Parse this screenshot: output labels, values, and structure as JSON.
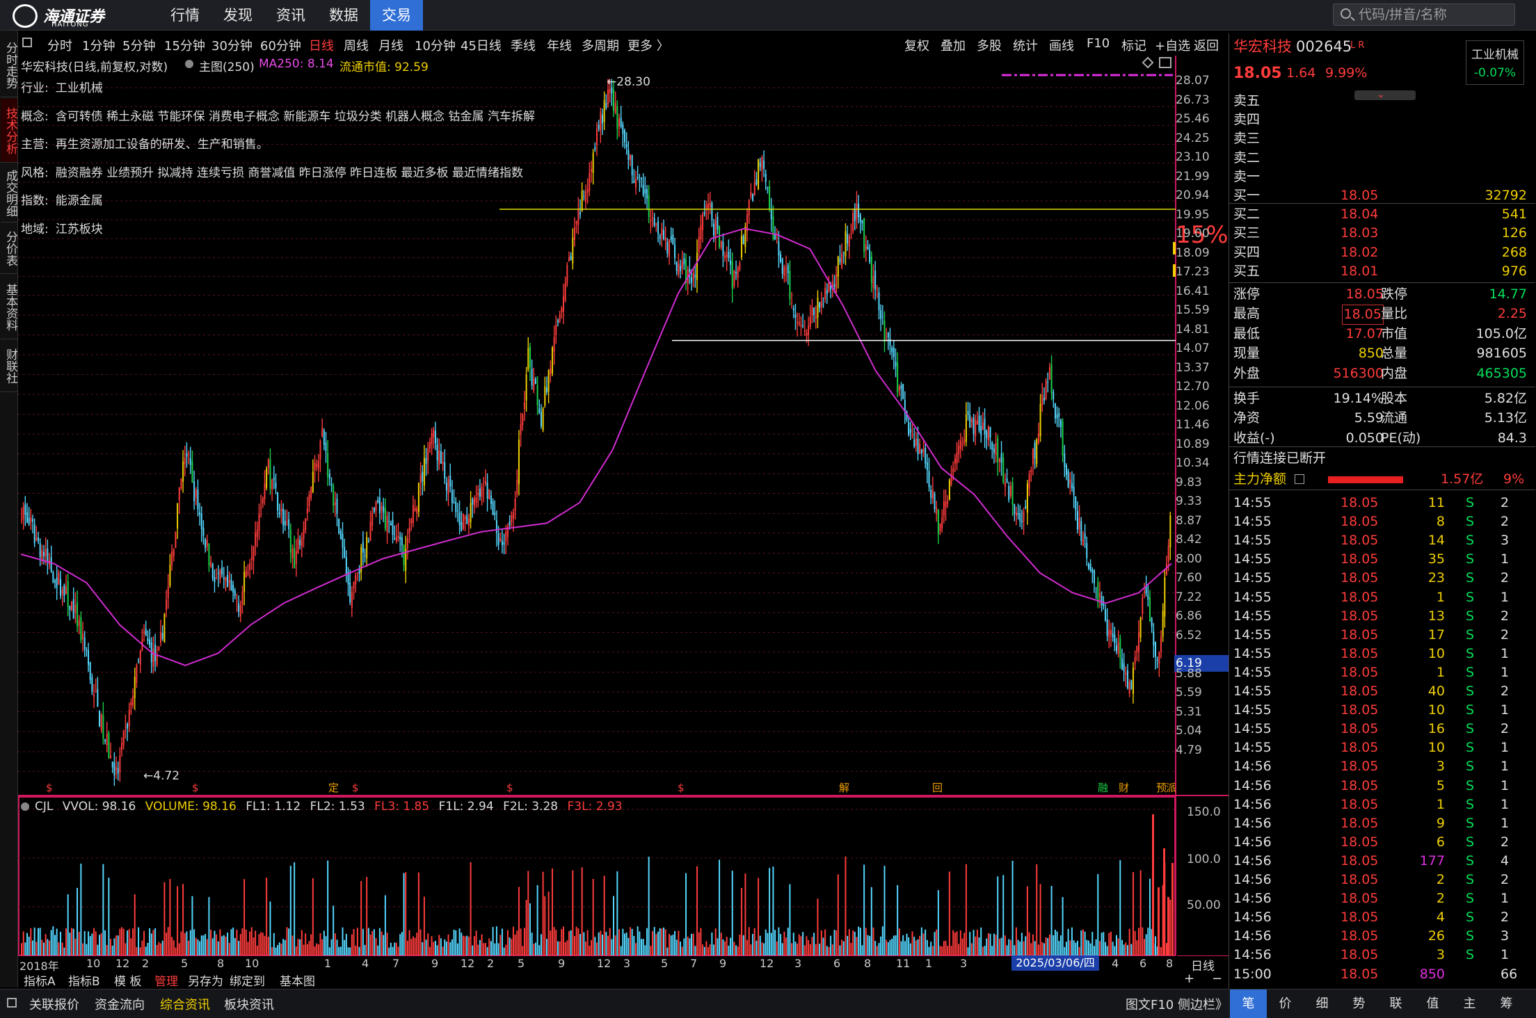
{
  "app": {
    "logo_cn": "海通证券",
    "logo_en": "HAITONG"
  },
  "topnav": [
    "行情",
    "发现",
    "资讯",
    "数据",
    "交易"
  ],
  "topnav_active": "交易",
  "search": {
    "placeholder": "代码/拼音/名称"
  },
  "left_tabs": [
    "分时走势",
    "技术分析",
    "成交明细",
    "分价表",
    "基本资料",
    "财联社"
  ],
  "left_tab_active": "技术分析",
  "periods": [
    "分时",
    "1分钟",
    "5分钟",
    "15分钟",
    "30分钟",
    "60分钟",
    "日线",
    "周线",
    "月线",
    "10分钟",
    "45日线",
    "季线",
    "年线",
    "多周期",
    "更多 〉"
  ],
  "period_active": "日线",
  "tools": [
    "复权",
    "叠加",
    "多股",
    "统计",
    "画线",
    "F10",
    "标记",
    "+自选",
    "返回"
  ],
  "header": {
    "stock": "华宏科技(日线,前复权,对数)",
    "main_label": "主图(250)",
    "ma_label": "MA250: 8.14",
    "float_label": "流通市值: 92.59"
  },
  "info_lines": [
    {
      "k": "行业:",
      "v": "工业机械"
    },
    {
      "k": "概念:",
      "v": "含可转债 稀土永磁 节能环保 消费电子概念 新能源车 垃圾分类 机器人概念 钴金属 汽车拆解"
    },
    {
      "k": "主营:",
      "v": "再生资源加工设备的研发、生产和销售。"
    },
    {
      "k": "风格:",
      "v": "融资融券 业绩预升 拟减持 连续亏损 商誉减值 昨日涨停 昨日连板 最近多板 最近情绪指数"
    },
    {
      "k": "指数:",
      "v": "能源金属"
    },
    {
      "k": "地域:",
      "v": "江苏板块"
    }
  ],
  "annotations": {
    "high": "28.30",
    "low": "4.72",
    "last_price_tag": "6.19",
    "limit_pct": "15%"
  },
  "event_marks": [
    "定",
    "解",
    "回",
    "融",
    "财",
    "预",
    "派"
  ],
  "sub_header": {
    "name": "CJL",
    "vvol": "VVOL: 98.16",
    "volume": "VOLUME: 98.16",
    "fl1": "FL1: 1.12",
    "fl2": "FL2: 1.53",
    "fl3": "FL3: 1.85",
    "f1l": "F1L: 2.94",
    "f2l": "F2L: 3.28",
    "f3l": "F3L: 2.93"
  },
  "x_axis": {
    "year": "2018年",
    "labels": [
      "10",
      "12",
      "2",
      "5",
      "8",
      "10",
      "1",
      "4",
      "7",
      "9",
      "12",
      "2",
      "5",
      "9",
      "12",
      "3",
      "5",
      "7",
      "9",
      "12",
      "3",
      "6",
      "8",
      "11",
      "1",
      "3",
      "4",
      "6",
      "8"
    ],
    "cursor_date": "2025/03/06/四",
    "period_tag": "日线"
  },
  "indicator_tabs": [
    "指标A",
    "指标B",
    "模 板",
    "管理",
    "另存为",
    "绑定到",
    "基本图"
  ],
  "indicator_active": "管理",
  "bottom_links": [
    "关联报价",
    "资金流向",
    "综合资讯",
    "板块资讯"
  ],
  "bottom_active": "综合资讯",
  "bottom_right": "图文F10 侧边栏》",
  "bottom_tabs": [
    "笔",
    "价",
    "细",
    "势",
    "联",
    "值",
    "主",
    "筹"
  ],
  "quote": {
    "name": "华宏科技",
    "code": "002645",
    "flags": "L R",
    "industry": "工业机械",
    "industry_chg": "-0.07%",
    "price": "18.05",
    "change": "1.64",
    "pct": "9.99%"
  },
  "sell_rows": [
    {
      "label": "卖五"
    },
    {
      "label": "卖四"
    },
    {
      "label": "卖三"
    },
    {
      "label": "卖二"
    },
    {
      "label": "卖一"
    }
  ],
  "buy_rows": [
    {
      "label": "买一",
      "price": "18.05",
      "vol": "32792"
    },
    {
      "label": "买二",
      "price": "18.04",
      "vol": "541"
    },
    {
      "label": "买三",
      "price": "18.03",
      "vol": "126"
    },
    {
      "label": "买四",
      "price": "18.02",
      "vol": "268"
    },
    {
      "label": "买五",
      "price": "18.01",
      "vol": "976"
    }
  ],
  "stats": [
    {
      "l1": "涨停",
      "v1": "18.05",
      "l2": "跌停",
      "v2": "14.77"
    },
    {
      "l1": "最高",
      "v1": "18.05",
      "l2": "量比",
      "v2": "2.25"
    },
    {
      "l1": "最低",
      "v1": "17.07",
      "l2": "市值",
      "v2": "105.0亿"
    },
    {
      "l1": "现量",
      "v1": "850",
      "l2": "总量",
      "v2": "981605"
    },
    {
      "l1": "外盘",
      "v1": "516300",
      "l2": "内盘",
      "v2": "465305"
    }
  ],
  "stats2": [
    {
      "l1": "换手",
      "v1": "19.14%",
      "l2": "股本",
      "v2": "5.82亿"
    },
    {
      "l1": "净资",
      "v1": "5.59",
      "l2": "流通",
      "v2": "5.13亿"
    },
    {
      "l1": "收益(-)",
      "v1": "0.050",
      "l2": "PE(动)",
      "v2": "84.3"
    }
  ],
  "conn_status": "行情连接已断开",
  "main_flow": {
    "label": "主力净额",
    "value": "1.57亿",
    "pct": "9%"
  },
  "ticks": [
    {
      "t": "14:55",
      "p": "18.05",
      "v": "11",
      "s": "S",
      "n": "2"
    },
    {
      "t": "14:55",
      "p": "18.05",
      "v": "8",
      "s": "S",
      "n": "2"
    },
    {
      "t": "14:55",
      "p": "18.05",
      "v": "14",
      "s": "S",
      "n": "3"
    },
    {
      "t": "14:55",
      "p": "18.05",
      "v": "35",
      "s": "S",
      "n": "1"
    },
    {
      "t": "14:55",
      "p": "18.05",
      "v": "23",
      "s": "S",
      "n": "2"
    },
    {
      "t": "14:55",
      "p": "18.05",
      "v": "1",
      "s": "S",
      "n": "1"
    },
    {
      "t": "14:55",
      "p": "18.05",
      "v": "13",
      "s": "S",
      "n": "2"
    },
    {
      "t": "14:55",
      "p": "18.05",
      "v": "17",
      "s": "S",
      "n": "2"
    },
    {
      "t": "14:55",
      "p": "18.05",
      "v": "10",
      "s": "S",
      "n": "1"
    },
    {
      "t": "14:55",
      "p": "18.05",
      "v": "1",
      "s": "S",
      "n": "1"
    },
    {
      "t": "14:55",
      "p": "18.05",
      "v": "40",
      "s": "S",
      "n": "2"
    },
    {
      "t": "14:55",
      "p": "18.05",
      "v": "10",
      "s": "S",
      "n": "1"
    },
    {
      "t": "14:55",
      "p": "18.05",
      "v": "16",
      "s": "S",
      "n": "2"
    },
    {
      "t": "14:55",
      "p": "18.05",
      "v": "10",
      "s": "S",
      "n": "1"
    },
    {
      "t": "14:56",
      "p": "18.05",
      "v": "3",
      "s": "S",
      "n": "1"
    },
    {
      "t": "14:56",
      "p": "18.05",
      "v": "5",
      "s": "S",
      "n": "1"
    },
    {
      "t": "14:56",
      "p": "18.05",
      "v": "1",
      "s": "S",
      "n": "1"
    },
    {
      "t": "14:56",
      "p": "18.05",
      "v": "9",
      "s": "S",
      "n": "1"
    },
    {
      "t": "14:56",
      "p": "18.05",
      "v": "6",
      "s": "S",
      "n": "2"
    },
    {
      "t": "14:56",
      "p": "18.05",
      "v": "177",
      "s": "S",
      "n": "4"
    },
    {
      "t": "14:56",
      "p": "18.05",
      "v": "2",
      "s": "S",
      "n": "2"
    },
    {
      "t": "14:56",
      "p": "18.05",
      "v": "2",
      "s": "S",
      "n": "1"
    },
    {
      "t": "14:56",
      "p": "18.05",
      "v": "4",
      "s": "S",
      "n": "2"
    },
    {
      "t": "14:56",
      "p": "18.05",
      "v": "26",
      "s": "S",
      "n": "3"
    },
    {
      "t": "14:56",
      "p": "18.05",
      "v": "3",
      "s": "S",
      "n": "1"
    },
    {
      "t": "15:00",
      "p": "18.05",
      "v": "850",
      "s": "",
      "n": "66"
    }
  ],
  "colors": {
    "up": "#ff3c3c",
    "down": "#54d8ff",
    "ma": "#d02cd0",
    "limit": "#f0d000",
    "bg": "#000000",
    "accent": "#2f6fd6"
  },
  "chart_data": {
    "type": "candlestick",
    "title": "华宏科技(日线,前复权,对数)",
    "y_scale": "log",
    "ylim": [
      4.5,
      29.0
    ],
    "y_ticks": [
      "28.07",
      "26.73",
      "25.46",
      "24.25",
      "23.10",
      "21.99",
      "20.94",
      "19.95",
      "19.00",
      "18.09",
      "17.23",
      "16.41",
      "15.59",
      "14.81",
      "14.07",
      "13.37",
      "12.70",
      "12.06",
      "11.46",
      "10.89",
      "10.34",
      "9.83",
      "9.33",
      "8.87",
      "8.42",
      "8.00",
      "7.60",
      "7.22",
      "6.86",
      "6.52",
      "6.19",
      "5.88",
      "5.59",
      "5.31",
      "5.04",
      "4.79"
    ],
    "x_range": [
      "2018-08",
      "2025-08"
    ],
    "price_path_months": [
      "2018-08",
      "2018-10",
      "2018-12",
      "2019-02",
      "2019-03",
      "2019-05",
      "2019-06",
      "2019-08",
      "2019-10",
      "2019-12",
      "2020-02",
      "2020-04",
      "2020-06",
      "2020-08",
      "2020-10",
      "2020-12",
      "2021-02",
      "2021-04",
      "2021-06",
      "2021-07",
      "2021-08",
      "2021-09",
      "2021-10",
      "2021-12",
      "2022-01",
      "2022-03",
      "2022-04",
      "2022-05",
      "2022-07",
      "2022-09",
      "2022-10",
      "2022-12",
      "2023-02",
      "2023-03",
      "2023-05",
      "2023-07",
      "2023-09",
      "2023-11",
      "2024-01",
      "2024-02",
      "2024-03",
      "2024-05",
      "2024-07",
      "2024-09",
      "2024-11",
      "2025-01",
      "2025-03",
      "2025-05",
      "2025-06",
      "2025-07",
      "2025-08"
    ],
    "close_path": [
      9.5,
      8.2,
      7.2,
      5.3,
      4.72,
      6.8,
      6.3,
      11.0,
      8.0,
      7.4,
      10.5,
      8.3,
      11.5,
      7.6,
      9.5,
      8.4,
      11.5,
      9.0,
      10.0,
      8.6,
      9.6,
      14.0,
      12.0,
      18.0,
      21.0,
      28.3,
      24.0,
      22.0,
      19.0,
      16.8,
      21.0,
      17.0,
      23.5,
      19.0,
      15.0,
      16.5,
      20.5,
      15.0,
      11.5,
      10.8,
      9.0,
      11.8,
      11.3,
      9.0,
      13.5,
      9.3,
      7.2,
      6.0,
      7.8,
      6.2,
      9.5
    ],
    "ma250_path": [
      8.4,
      8.2,
      7.8,
      7.0,
      6.5,
      6.3,
      6.5,
      7.0,
      7.4,
      7.7,
      8.0,
      8.3,
      8.5,
      8.7,
      8.9,
      9.0,
      9.1,
      9.6,
      11.0,
      13.5,
      16.5,
      19.0,
      19.5,
      19.2,
      18.5,
      16.0,
      13.5,
      12.0,
      10.5,
      9.8,
      8.8,
      8.0,
      7.6,
      7.4,
      7.6,
      8.2
    ],
    "last_close": 18.05,
    "ma250": 8.14,
    "limit_pct": 15,
    "volume_ylim": [
      0,
      160
    ],
    "volume_ticks": [
      "150.0",
      "100.0",
      "50.00"
    ],
    "volume_last": 98.16
  }
}
